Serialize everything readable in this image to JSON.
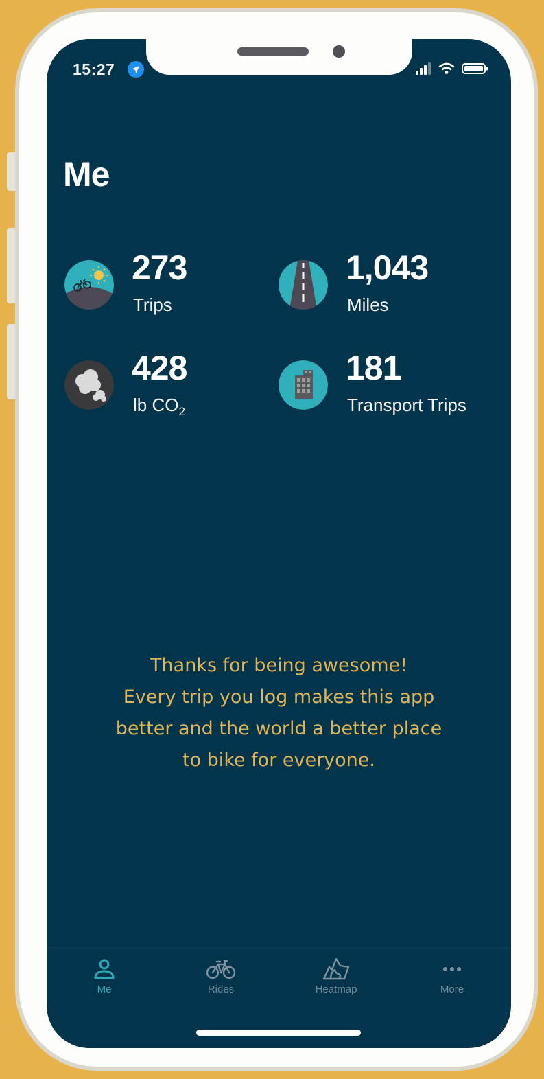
{
  "status_bar": {
    "time": "15:27"
  },
  "header": {
    "title": "Me"
  },
  "stats": [
    {
      "value": "273",
      "label": "Trips",
      "icon": "bike-sun-icon"
    },
    {
      "value": "1,043",
      "label": "Miles",
      "icon": "road-icon"
    },
    {
      "value": "428",
      "label_main": "lb CO",
      "label_sub": "2",
      "icon": "smoke-icon"
    },
    {
      "value": "181",
      "label": "Transport Trips",
      "icon": "building-icon"
    }
  ],
  "message": {
    "lines": [
      "Thanks for being awesome!",
      "Every trip you log makes this app",
      "better and the world a better place",
      "to bike for everyone."
    ]
  },
  "tabbar": {
    "items": [
      {
        "label": "Me",
        "icon": "person-icon",
        "active": true
      },
      {
        "label": "Rides",
        "icon": "bicycle-icon",
        "active": false
      },
      {
        "label": "Heatmap",
        "icon": "heatmap-icon",
        "active": false
      },
      {
        "label": "More",
        "icon": "more-dots-icon",
        "active": false
      }
    ]
  },
  "colors": {
    "background": "#02344C",
    "accent": "#2FA9B4",
    "message": "#E0B458",
    "frame_outer": "#E8B24A"
  }
}
